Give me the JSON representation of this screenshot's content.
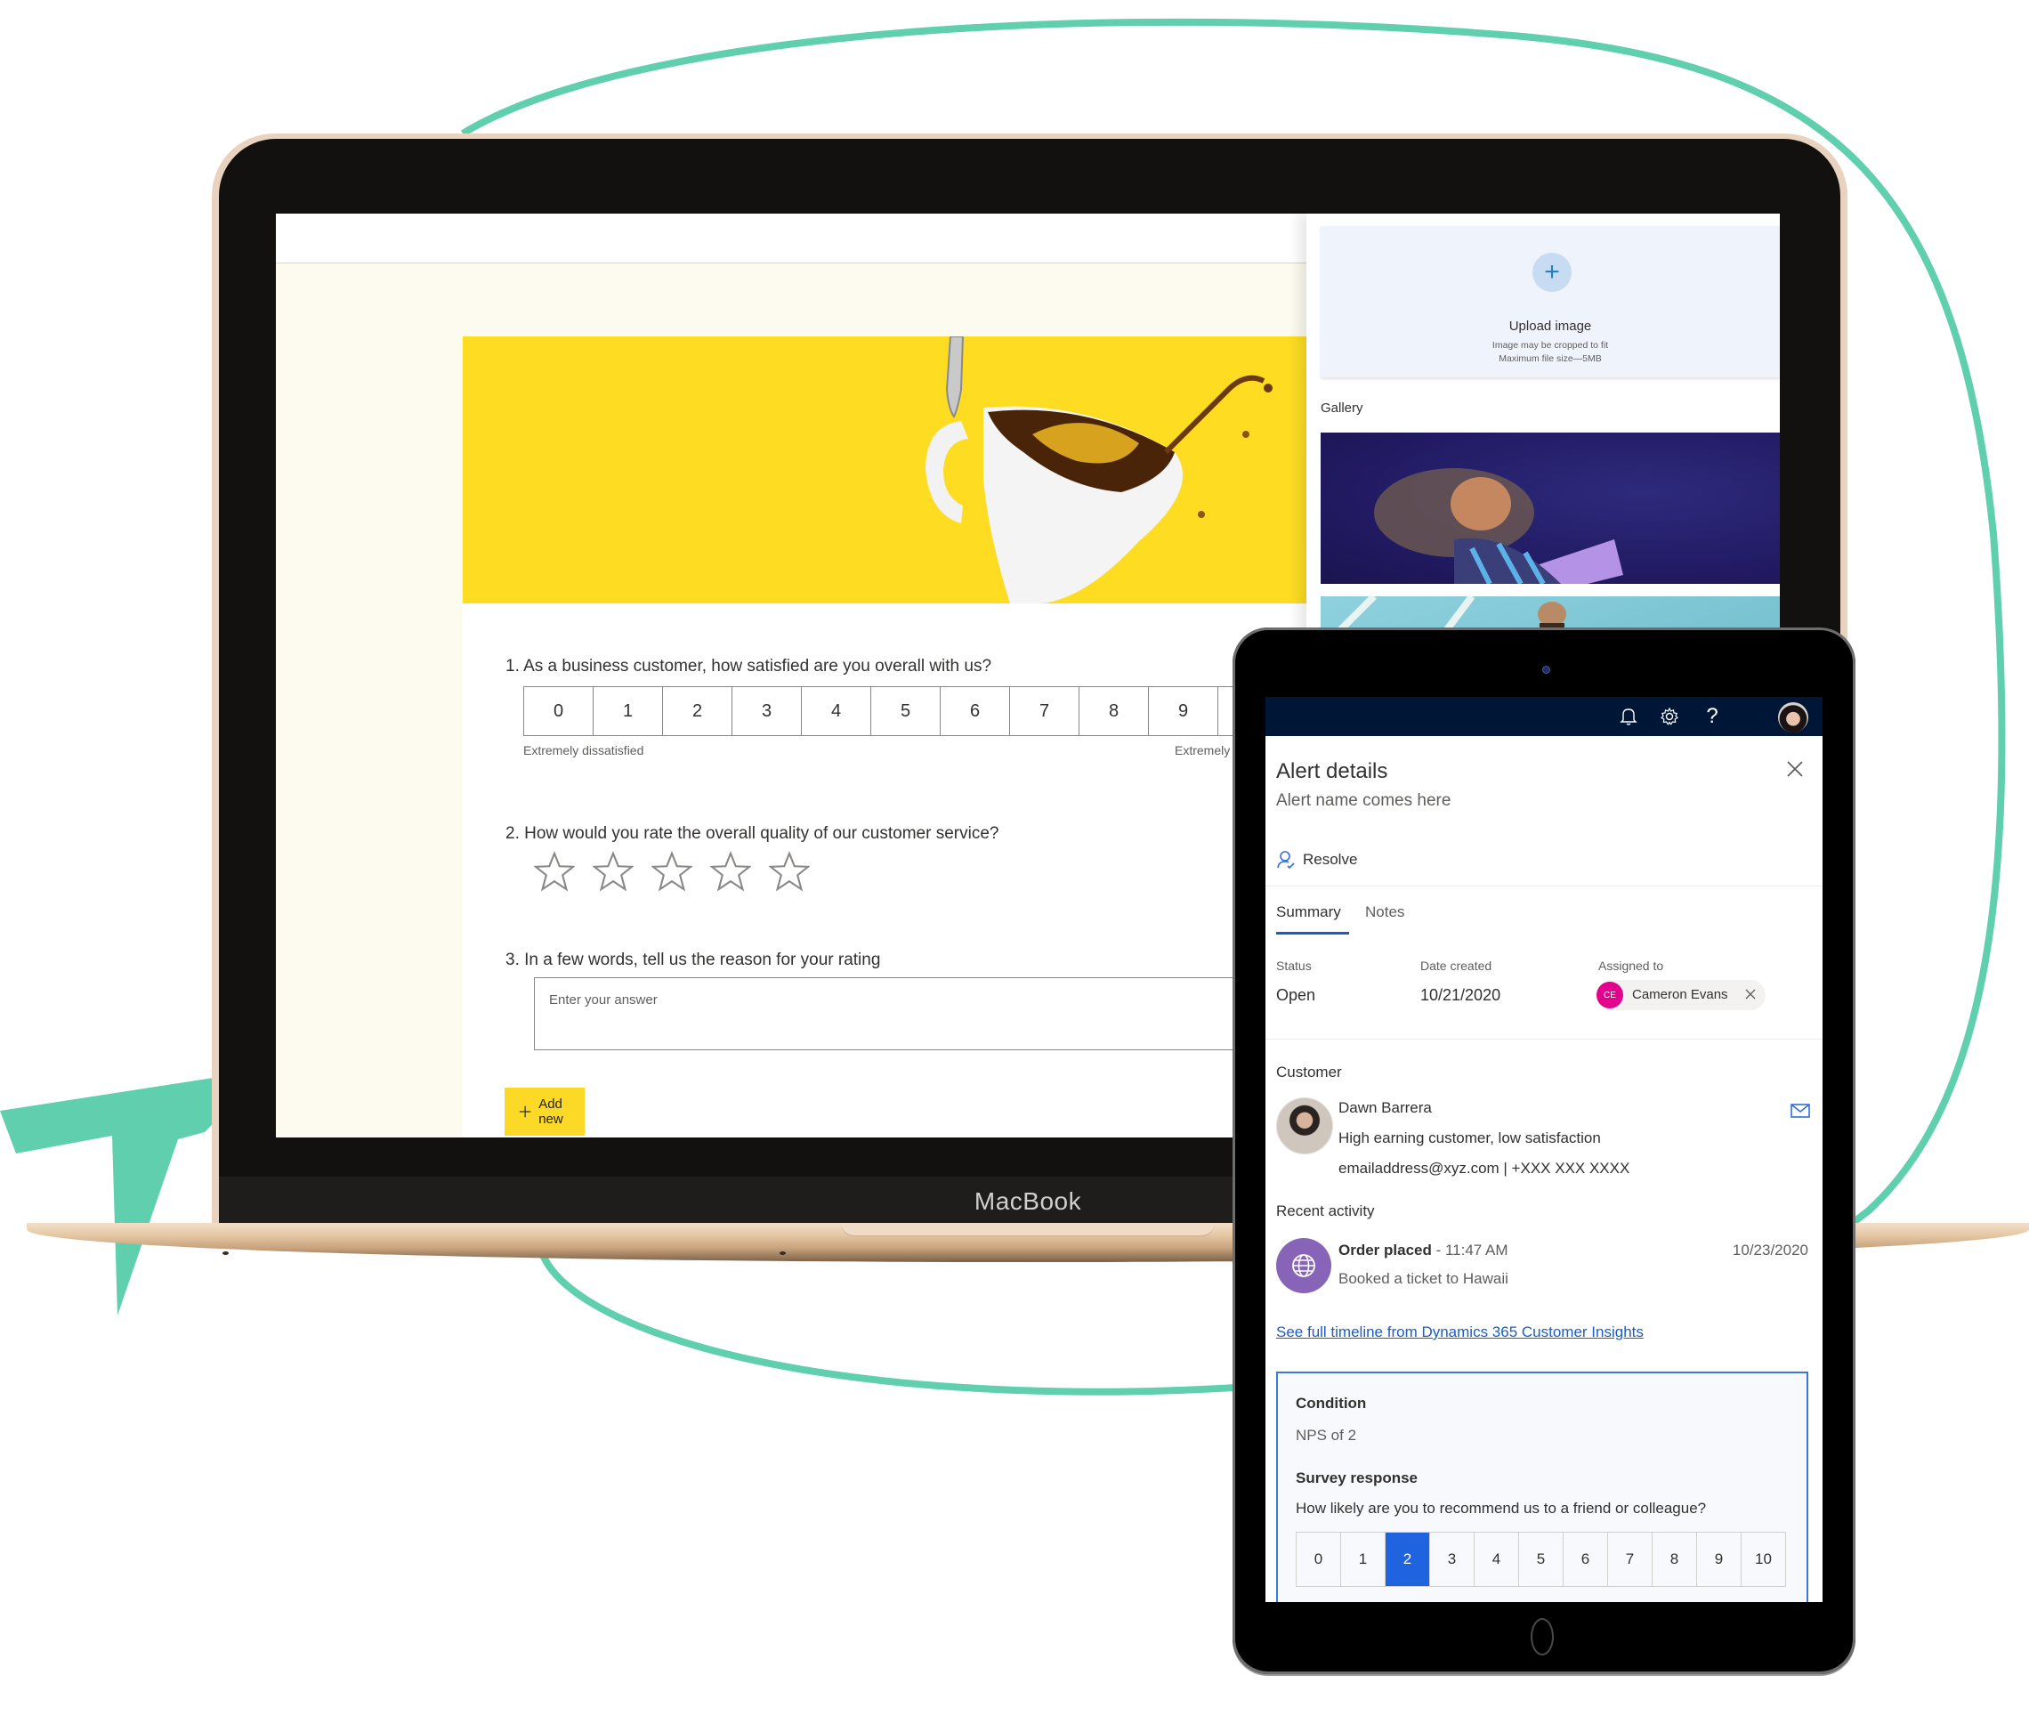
{
  "laptop": {
    "brand_label": "MacBook",
    "survey": {
      "questions": [
        {
          "number": "1.",
          "text": "As a business customer, how satisfied are you overall with us?",
          "type": "scale",
          "scale": [
            "0",
            "1",
            "2",
            "3",
            "4",
            "5",
            "6",
            "7",
            "8",
            "9"
          ],
          "low_label": "Extremely dissatisfied",
          "high_label": "Extremely"
        },
        {
          "number": "2.",
          "text": "How would you rate the overall quality of our customer service?",
          "type": "stars",
          "star_count": 5,
          "rating": 0
        },
        {
          "number": "3.",
          "text": "In a few words, tell us the reason for your rating",
          "type": "text",
          "placeholder": "Enter your answer",
          "value": ""
        }
      ],
      "add_new_label": "Add new"
    },
    "panel": {
      "upload": {
        "title": "Upload image",
        "line1": "Image may be cropped to fit",
        "line2": "Maximum file size—5MB"
      },
      "gallery_label": "Gallery"
    }
  },
  "tablet": {
    "topbar_icons": [
      "bell-icon",
      "gear-icon",
      "help-icon",
      "avatar"
    ],
    "title": "Alert details",
    "subtitle": "Alert name comes here",
    "resolve_label": "Resolve",
    "tabs": [
      {
        "label": "Summary",
        "active": true
      },
      {
        "label": "Notes",
        "active": false
      }
    ],
    "fields": {
      "status_label": "Status",
      "status_value": "Open",
      "date_label": "Date created",
      "date_value": "10/21/2020",
      "assigned_label": "Assigned to",
      "assigned_initials": "CE",
      "assigned_name": "Cameron Evans"
    },
    "customer": {
      "section_label": "Customer",
      "name": "Dawn Barrera",
      "description": "High earning customer, low satisfaction",
      "contact": "emailaddress@xyz.com | +XXX XXX XXXX"
    },
    "recent_activity": {
      "section_label": "Recent activity",
      "title": "Order placed",
      "time": " - 11:47 AM",
      "date": "10/23/2020",
      "description": "Booked a ticket to Hawaii"
    },
    "timeline_link": "See full timeline from Dynamics 365 Customer Insights",
    "condition": {
      "label": "Condition",
      "value": "NPS of 2",
      "survey_label": "Survey response",
      "survey_question": "How likely are you to recommend us to a friend or colleague?",
      "scale": [
        "0",
        "1",
        "2",
        "3",
        "4",
        "5",
        "6",
        "7",
        "8",
        "9",
        "10"
      ],
      "selected": "2"
    }
  },
  "colors": {
    "accent_teal": "#5fcfae",
    "survey_yellow": "#fedc22",
    "tablet_topbar": "#001636",
    "link_blue": "#1a5dc8",
    "nps_selected": "#1f63df",
    "persona_magenta": "#e3008c",
    "activity_purple": "#8764b8"
  }
}
